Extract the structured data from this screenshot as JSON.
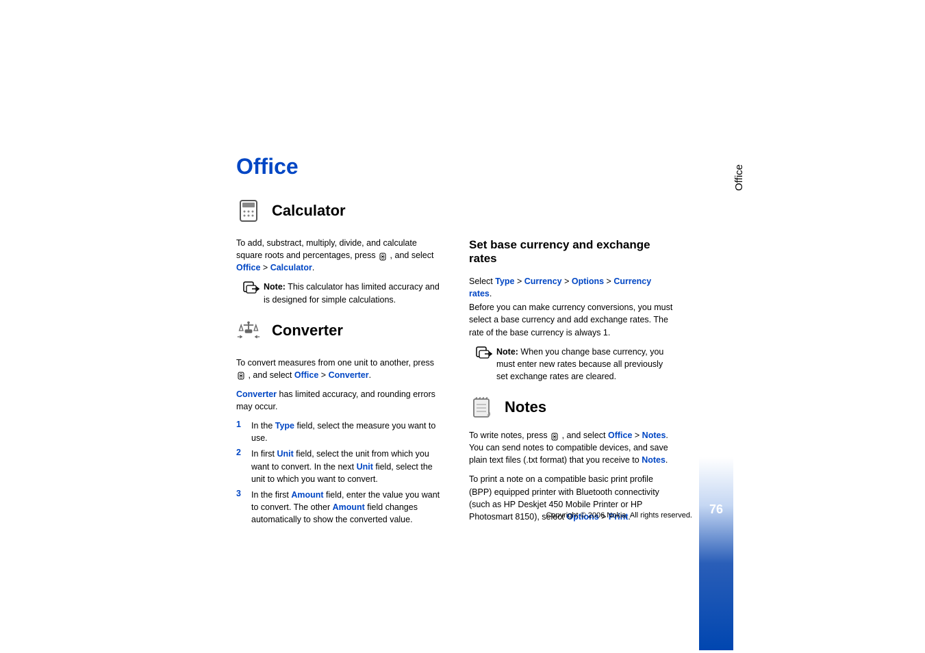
{
  "pageTitle": "Office",
  "sideTab": "Office",
  "pageNumber": "76",
  "copyright": "Copyright © 2006 Nokia. All rights reserved.",
  "calculator": {
    "heading": "Calculator",
    "intro1": "To add, substract, multiply, divide, and calculate square roots and percentages, press ",
    "intro2": " , and select ",
    "linkOffice": "Office",
    "sep": " > ",
    "linkCalculator": "Calculator",
    "period": ".",
    "noteLabel": "Note:",
    "noteText": " This calculator has limited accuracy and is designed for simple calculations."
  },
  "converter": {
    "heading": "Converter",
    "intro1": "To convert measures from one unit to another, press ",
    "intro2": " , and select ",
    "linkOffice": "Office",
    "sep": " > ",
    "linkConverter": "Converter",
    "period": ".",
    "limited1": "Converter",
    "limited2": " has limited accuracy, and rounding errors may occur.",
    "li1a": "In the ",
    "li1Type": "Type",
    "li1b": " field, select the measure you want to use.",
    "li2a": "In first ",
    "li2Unit1": "Unit",
    "li2b": " field, select the unit from which you want to convert. In the next ",
    "li2Unit2": "Unit",
    "li2c": " field, select the unit to which you want to convert.",
    "li3a": "In the first ",
    "li3Amount1": "Amount",
    "li3b": " field, enter the value you want to convert. The other ",
    "li3Amount2": "Amount",
    "li3c": " field changes automatically to show the converted value."
  },
  "exchange": {
    "heading": "Set base currency and exchange rates",
    "select": "Select ",
    "type": "Type",
    "currency": "Currency",
    "options": "Options",
    "rates": "Currency rates",
    "period": ".",
    "sep": " > ",
    "body": "Before you can make currency conversions, you must select a base currency and add exchange rates. The rate of the base currency is always 1.",
    "noteLabel": "Note:",
    "noteText": " When you change base currency, you must enter new rates because all previously set exchange rates are cleared."
  },
  "notes": {
    "heading": "Notes",
    "p1a": "To write notes, press ",
    "p1b": " , and select ",
    "office": "Office",
    "sep": " > ",
    "notesLink": "Notes",
    "p1c": ". You can send notes to compatible devices, and save plain text files (.txt format) that you receive to ",
    "notesLink2": "Notes",
    "period": ".",
    "p2a": "To print a note on a compatible basic print profile (BPP) equipped printer with Bluetooth connectivity (such as HP Deskjet 450 Mobile Printer or HP Photosmart 8150), select ",
    "options": "Options",
    "print": "Print"
  },
  "nums": {
    "one": "1",
    "two": "2",
    "three": "3"
  }
}
